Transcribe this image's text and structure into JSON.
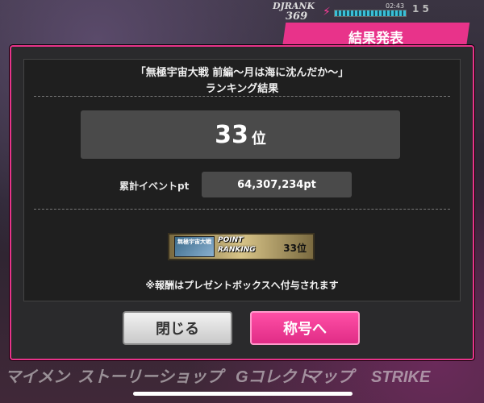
{
  "hud": {
    "rank_label": "DJRANK",
    "rank_value": "369",
    "clock": "02:43",
    "status_tail": "1 5"
  },
  "header": {
    "title": "結果発表"
  },
  "background_tabs": [
    "マイメン",
    "ストーリー",
    "ショップ",
    "Gコレクト",
    "マップ",
    "STRIKE"
  ],
  "dialog": {
    "event_title": "「無極宇宙大戦 前編～月は海に沈んだか～」",
    "result_heading": "ランキング結果",
    "rank_value": "33",
    "rank_suffix": "位",
    "points_label": "累計イベントpt",
    "points_value": "64,307,234pt",
    "badge": {
      "emblem_text": "無極宇宙大戦",
      "line1": "POINT",
      "line2": "RANKING",
      "rank": "33位"
    },
    "reward_note": "※報酬はプレゼントボックスへ付与されます",
    "close_label": "閉じる",
    "title_label": "称号へ"
  },
  "colors": {
    "accent": "#e8338a",
    "panel": "#2a2a2c",
    "value_box": "#4a4a4a"
  }
}
